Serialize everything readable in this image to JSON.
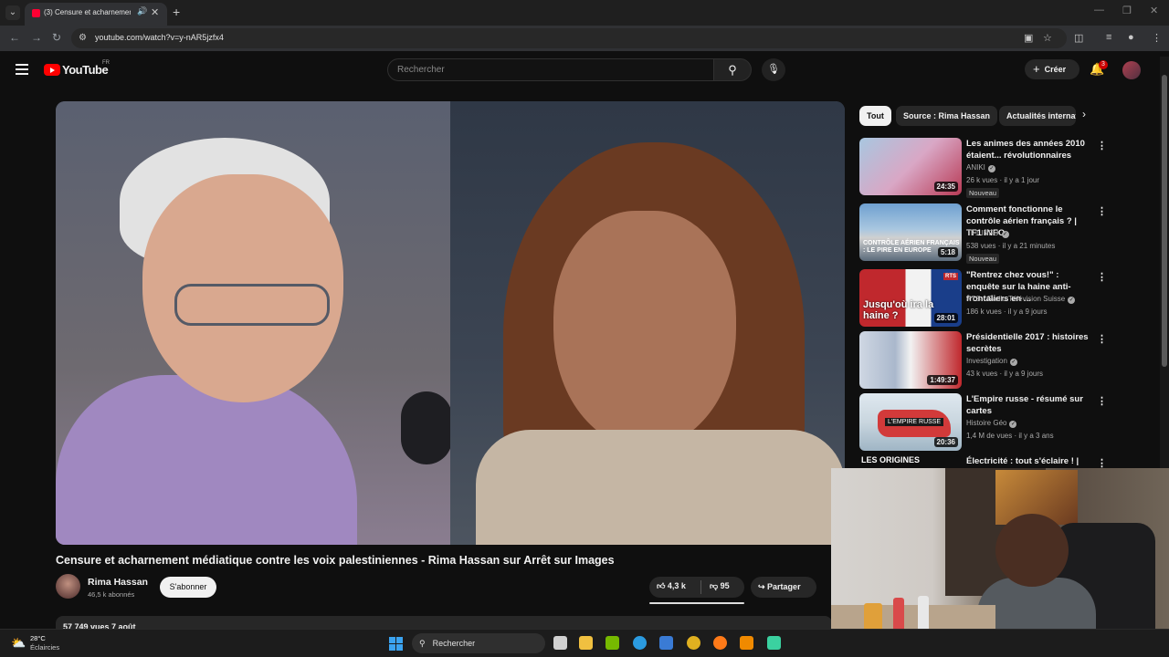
{
  "browser": {
    "tab_title": "(3) Censure et acharnement médiatique...",
    "url": "youtube.com/watch?v=y-nAR5jzfx4"
  },
  "header": {
    "logo_text": "YouTube",
    "region": "FR",
    "search_placeholder": "Rechercher",
    "create_label": "Créer",
    "notif_count": "3"
  },
  "video": {
    "title": "Censure et acharnement médiatique contre les voix palestiniennes - Rima Hassan sur Arrêt sur Images",
    "channel": "Rima Hassan",
    "subscribers": "46,5 k abonnés",
    "subscribe_label": "S'abonner",
    "likes": "4,3 k",
    "dislikes": "95",
    "share_label": "Partager",
    "views_date": "57 749 vues  7 août"
  },
  "chips": [
    "Tout",
    "Source : Rima Hassan",
    "Actualités internationales"
  ],
  "recommendations": [
    {
      "title": "Les animes des années 2010 étaient... révolutionnaires",
      "channel": "ANIKI",
      "meta": "26 k vues · il y a 1 jour",
      "duration": "24:35",
      "badge": "Nouveau"
    },
    {
      "title": "Comment fonctionne le contrôle aérien français ? | TF1 INFO",
      "channel": "TF1 INFO",
      "meta": "538 vues · il y a 21 minutes",
      "duration": "5:18",
      "badge": "Nouveau",
      "caption": "CONTRÔLE AÉRIEN FRANÇAIS : LE PIRE EN EUROPE"
    },
    {
      "title": "\"Rentrez chez vous!\" : enquête sur la haine anti-frontaliers en ...",
      "channel": "RTS - Radio Télévision Suisse",
      "meta": "186 k vues · il y a 9 jours",
      "duration": "28:01",
      "caption": "Jusqu'où ira la haine ?",
      "logo": "RTS"
    },
    {
      "title": "Présidentielle 2017 : histoires secrètes",
      "channel": "Investigation",
      "meta": "43 k vues · il y a 9 jours",
      "duration": "1:49:37"
    },
    {
      "title": "L'Empire russe - résumé sur cartes",
      "channel": "Histoire Géo",
      "meta": "1,4 M de vues · il y a 3 ans",
      "duration": "20:36",
      "caption": "L'EMPIRE RUSSE"
    },
    {
      "title": "Électricité : tout s'éclaire ! |",
      "caption": "LES ORIGINES"
    }
  ],
  "taskbar": {
    "temperature": "28°C",
    "weather": "Éclaircies",
    "search_label": "Rechercher"
  }
}
